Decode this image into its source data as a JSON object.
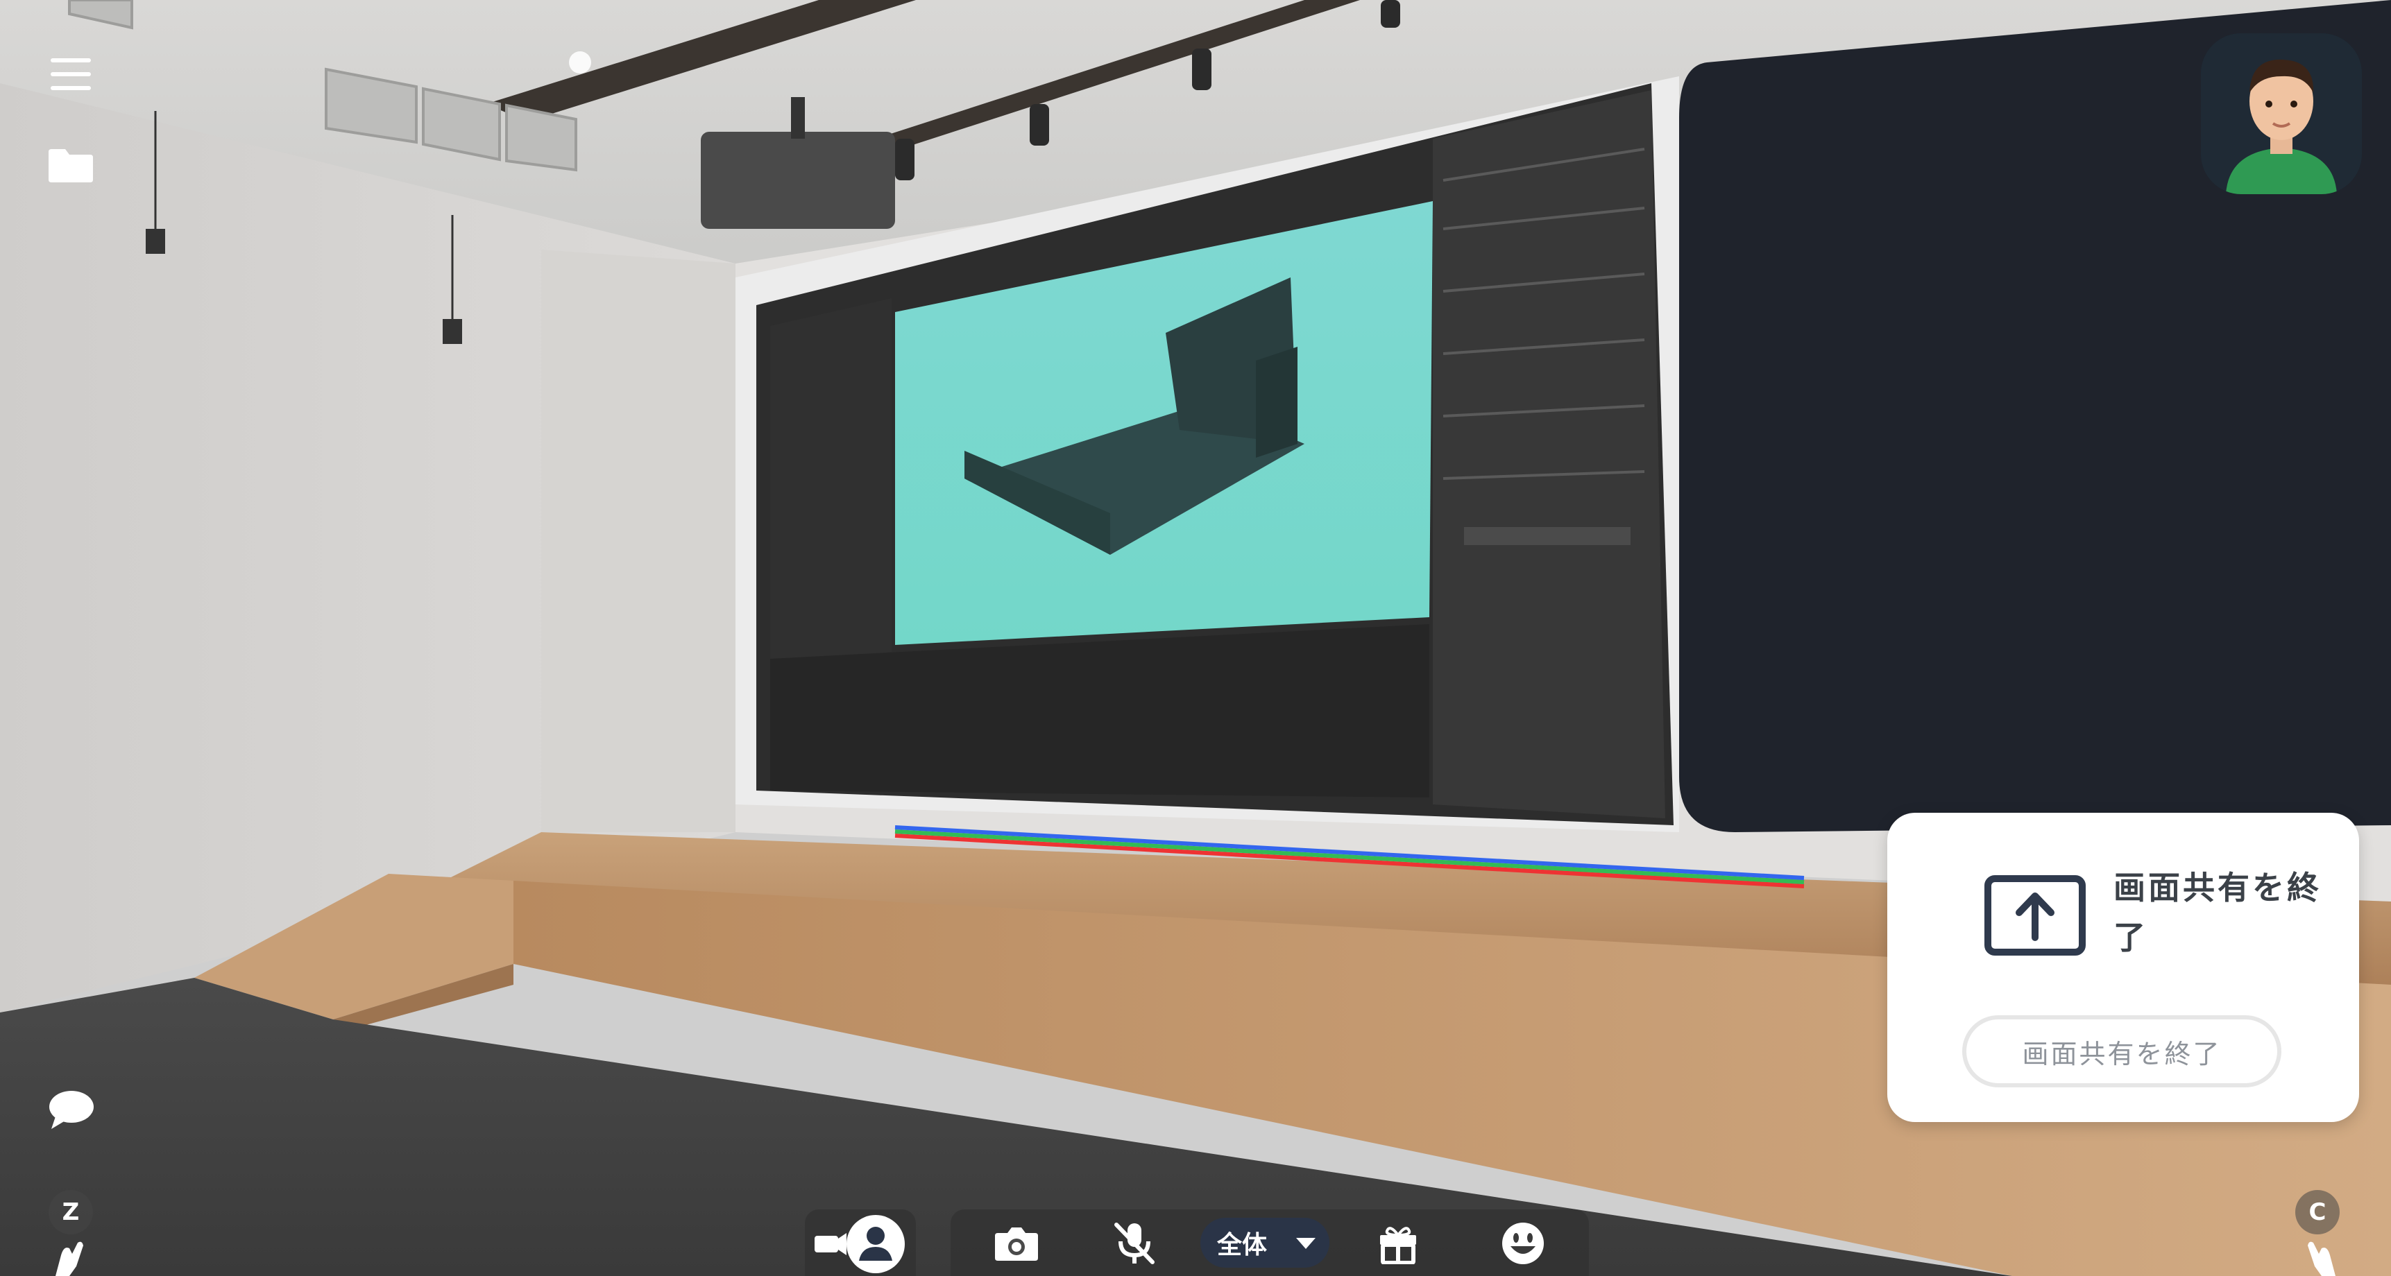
{
  "hud": {
    "menu_icon": "hamburger-menu-icon",
    "folder_icon": "folder-icon",
    "chat_icon": "speech-bubble-icon",
    "left_key_label": "Z",
    "right_key_label": "C"
  },
  "share_panel": {
    "icon": "upload-arrow-screen-icon",
    "title": "画面共有を終了",
    "end_button_label": "画面共有を終了"
  },
  "toolbar": {
    "camera_toggle_icon": "camera-person-toggle-icon",
    "screenshot_icon": "camera-icon",
    "mic_icon": "microphone-muted-icon",
    "scope_label": "全体",
    "gift_icon": "gift-icon",
    "emote_icon": "smiley-icon"
  },
  "colors": {
    "panel_text": "#3b4148",
    "scope_pill": "#2a3447",
    "accent_ui": "#2f3a4d",
    "avatar_bg": "#1f2a35"
  }
}
